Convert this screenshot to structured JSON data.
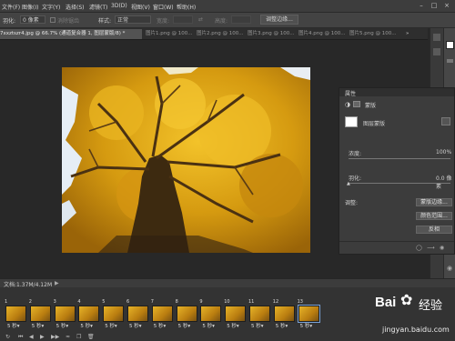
{
  "menu": {
    "items": [
      "文件(F)",
      "图像(I)",
      "文字(Y)",
      "选择(S)",
      "滤镜(T)",
      "3D(D)",
      "视图(V)",
      "窗口(W)",
      "帮助(H)"
    ],
    "window_controls": [
      "minimize-icon",
      "restore-icon",
      "close-icon"
    ]
  },
  "options": {
    "feather_label": "羽化:",
    "feather_value": "0 像素",
    "antialias_label": "消除锯齿",
    "style_label": "样式:",
    "style_value": "正常",
    "width_label": "宽度:",
    "height_label": "高度:",
    "refine_button": "调整边缘..."
  },
  "tabs": [
    {
      "label": "7xxztszr4.jpg @ 66.7% (通道复合器 1, 图层蒙版/8) *",
      "active": true
    },
    {
      "label": "图片1.png @ 100...",
      "active": false
    },
    {
      "label": "图片2.png @ 100...",
      "active": false
    },
    {
      "label": "图片3.png @ 100...",
      "active": false
    },
    {
      "label": "图片4.png @ 100...",
      "active": false
    },
    {
      "label": "图片5.png @ 100...",
      "active": false
    }
  ],
  "panel": {
    "tab_label": "属性",
    "header_label": "蒙版",
    "mask_type": "图层蒙版",
    "density_label": "浓度:",
    "density_value": "100%",
    "feather_label": "羽化:",
    "feather_value": "0.0 像素",
    "adjust_label": "调整:",
    "mask_edge_button": "蒙版边缘...",
    "color_range_button": "颜色范围...",
    "invert_button": "反相"
  },
  "status": {
    "doc_label": "文档:1.37M/4.12M"
  },
  "timeline": {
    "frames": [
      {
        "num": "1",
        "duration": "5 秒▾"
      },
      {
        "num": "2",
        "duration": "5 秒▾"
      },
      {
        "num": "3",
        "duration": "5 秒▾"
      },
      {
        "num": "4",
        "duration": "5 秒▾"
      },
      {
        "num": "5",
        "duration": "5 秒▾"
      },
      {
        "num": "6",
        "duration": "5 秒▾"
      },
      {
        "num": "7",
        "duration": "5 秒▾"
      },
      {
        "num": "8",
        "duration": "5 秒▾"
      },
      {
        "num": "9",
        "duration": "5 秒▾"
      },
      {
        "num": "10",
        "duration": "5 秒▾"
      },
      {
        "num": "11",
        "duration": "5 秒▾"
      },
      {
        "num": "12",
        "duration": "5 秒▾"
      },
      {
        "num": "13",
        "duration": "5 秒▾"
      }
    ],
    "selected_frame": "13"
  },
  "watermark": {
    "brand": "Bai",
    "brand_cn": "经验",
    "url": "jingyan.baidu.com"
  },
  "colors": {
    "accent": "#7aa2d6",
    "photo_gold": "#d9a416"
  }
}
